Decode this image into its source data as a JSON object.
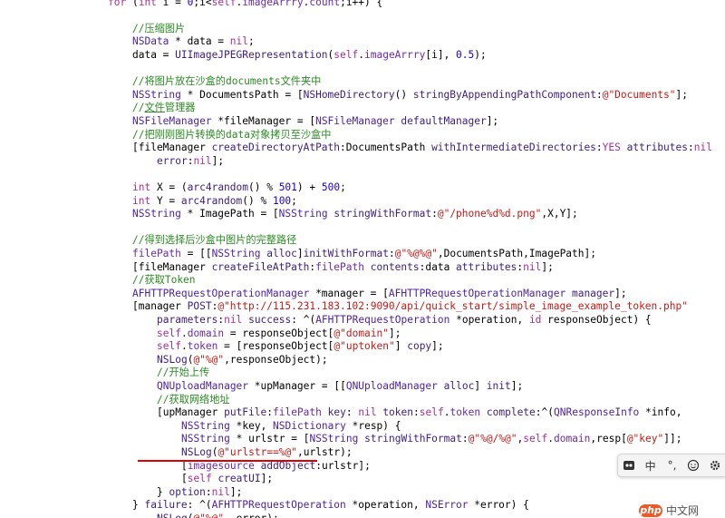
{
  "editor": {
    "lines": [
      {
        "indent": 8,
        "tokens": [
          [
            "kw",
            "for"
          ],
          [
            "p",
            " ("
          ],
          [
            "kw",
            "int"
          ],
          [
            "p",
            " i = "
          ],
          [
            "num",
            "0"
          ],
          [
            "p",
            ";i<"
          ],
          [
            "kw",
            "self"
          ],
          [
            "p",
            "."
          ],
          [
            "prop",
            "imageArrry"
          ],
          [
            "p",
            "."
          ],
          [
            "prop",
            "count"
          ],
          [
            "p",
            ";i++) {"
          ]
        ]
      },
      {
        "indent": 0,
        "tokens": []
      },
      {
        "indent": 12,
        "tokens": [
          [
            "cmt",
            "//压缩图片"
          ]
        ]
      },
      {
        "indent": 12,
        "tokens": [
          [
            "cls",
            "NSData"
          ],
          [
            "p",
            " * data = "
          ],
          [
            "kw",
            "nil"
          ],
          [
            "p",
            ";"
          ]
        ]
      },
      {
        "indent": 12,
        "tokens": [
          [
            "p",
            "data = "
          ],
          [
            "mth",
            "UIImageJPEGRepresentation"
          ],
          [
            "p",
            "("
          ],
          [
            "kw",
            "self"
          ],
          [
            "p",
            "."
          ],
          [
            "prop",
            "imageArrry"
          ],
          [
            "p",
            "[i], "
          ],
          [
            "num",
            "0.5"
          ],
          [
            "p",
            ");"
          ]
        ]
      },
      {
        "indent": 0,
        "tokens": []
      },
      {
        "indent": 12,
        "tokens": [
          [
            "cmt",
            "//将图片放在沙盒的documents文件夹中"
          ]
        ]
      },
      {
        "indent": 12,
        "tokens": [
          [
            "cls",
            "NSString"
          ],
          [
            "p",
            " * DocumentsPath = ["
          ],
          [
            "mth",
            "NSHomeDirectory"
          ],
          [
            "p",
            "() "
          ],
          [
            "mth",
            "stringByAppendingPathComponent"
          ],
          [
            "p",
            ":"
          ],
          [
            "str",
            "@\"Documents\""
          ],
          [
            "p",
            "];"
          ]
        ]
      },
      {
        "indent": 12,
        "tokens": [
          [
            "cmt",
            "//"
          ],
          [
            "link",
            "文件"
          ],
          [
            "cmt",
            "管理器"
          ]
        ]
      },
      {
        "indent": 12,
        "tokens": [
          [
            "cls",
            "NSFileManager"
          ],
          [
            "p",
            " *fileManager = ["
          ],
          [
            "cls",
            "NSFileManager"
          ],
          [
            "p",
            " "
          ],
          [
            "mth",
            "defaultManager"
          ],
          [
            "p",
            "];"
          ]
        ]
      },
      {
        "indent": 12,
        "tokens": [
          [
            "cmt",
            "//把刚刚图片转换的data对象拷贝至沙盒中"
          ]
        ]
      },
      {
        "indent": 12,
        "tokens": [
          [
            "p",
            "[fileManager "
          ],
          [
            "mth",
            "createDirectoryAtPath"
          ],
          [
            "p",
            ":DocumentsPath "
          ],
          [
            "mth",
            "withIntermediateDirectories"
          ],
          [
            "p",
            ":"
          ],
          [
            "kw",
            "YES"
          ],
          [
            "p",
            " "
          ],
          [
            "mth",
            "attributes"
          ],
          [
            "p",
            ":"
          ],
          [
            "kw",
            "nil"
          ]
        ]
      },
      {
        "indent": 16,
        "tokens": [
          [
            "mth",
            "error"
          ],
          [
            "p",
            ":"
          ],
          [
            "kw",
            "nil"
          ],
          [
            "p",
            "];"
          ]
        ]
      },
      {
        "indent": 0,
        "tokens": []
      },
      {
        "indent": 12,
        "tokens": [
          [
            "kw",
            "int"
          ],
          [
            "p",
            " X = ("
          ],
          [
            "mth",
            "arc4random"
          ],
          [
            "p",
            "() % "
          ],
          [
            "num",
            "501"
          ],
          [
            "p",
            ") + "
          ],
          [
            "num",
            "500"
          ],
          [
            "p",
            ";"
          ]
        ]
      },
      {
        "indent": 12,
        "tokens": [
          [
            "kw",
            "int"
          ],
          [
            "p",
            " Y = "
          ],
          [
            "mth",
            "arc4random"
          ],
          [
            "p",
            "() % "
          ],
          [
            "num",
            "100"
          ],
          [
            "p",
            ";"
          ]
        ]
      },
      {
        "indent": 12,
        "tokens": [
          [
            "cls",
            "NSString"
          ],
          [
            "p",
            " * ImagePath = ["
          ],
          [
            "cls",
            "NSString"
          ],
          [
            "p",
            " "
          ],
          [
            "mth",
            "stringWithFormat"
          ],
          [
            "p",
            ":"
          ],
          [
            "str",
            "@\"/phone%d%d.png\""
          ],
          [
            "p",
            ",X,Y];"
          ]
        ]
      },
      {
        "indent": 0,
        "tokens": []
      },
      {
        "indent": 12,
        "tokens": [
          [
            "cmt",
            "//得到选择后沙盒中图片的完整路径"
          ]
        ]
      },
      {
        "indent": 12,
        "tokens": [
          [
            "prop",
            "filePath"
          ],
          [
            "p",
            " = [["
          ],
          [
            "cls",
            "NSString"
          ],
          [
            "p",
            " "
          ],
          [
            "mth",
            "alloc"
          ],
          [
            "p",
            "]"
          ],
          [
            "mth",
            "initWithFormat"
          ],
          [
            "p",
            ":"
          ],
          [
            "str",
            "@\"%@%@\""
          ],
          [
            "p",
            ",DocumentsPath,ImagePath];"
          ]
        ]
      },
      {
        "indent": 12,
        "tokens": [
          [
            "p",
            "[fileManager "
          ],
          [
            "mth",
            "createFileAtPath"
          ],
          [
            "p",
            ":"
          ],
          [
            "prop",
            "filePath"
          ],
          [
            "p",
            " "
          ],
          [
            "mth",
            "contents"
          ],
          [
            "p",
            ":data "
          ],
          [
            "mth",
            "attributes"
          ],
          [
            "p",
            ":"
          ],
          [
            "kw",
            "nil"
          ],
          [
            "p",
            "];"
          ]
        ]
      },
      {
        "indent": 12,
        "tokens": [
          [
            "cmt",
            "//获取Token"
          ]
        ]
      },
      {
        "indent": 12,
        "tokens": [
          [
            "cls",
            "AFHTTPRequestOperationManager"
          ],
          [
            "p",
            " *manager = ["
          ],
          [
            "cls",
            "AFHTTPRequestOperationManager"
          ],
          [
            "p",
            " "
          ],
          [
            "mth",
            "manager"
          ],
          [
            "p",
            "];"
          ]
        ]
      },
      {
        "indent": 12,
        "tokens": [
          [
            "p",
            "[manager "
          ],
          [
            "mth",
            "POST"
          ],
          [
            "p",
            ":"
          ],
          [
            "str",
            "@\"http://115.231.183.102:9090/api/quick_start/simple_image_example_token.php\""
          ]
        ]
      },
      {
        "indent": 16,
        "tokens": [
          [
            "mth",
            "parameters"
          ],
          [
            "p",
            ":"
          ],
          [
            "kw",
            "nil"
          ],
          [
            "p",
            " "
          ],
          [
            "mth",
            "success"
          ],
          [
            "p",
            ": ^("
          ],
          [
            "cls",
            "AFHTTPRequestOperation"
          ],
          [
            "p",
            " *operation, "
          ],
          [
            "kw",
            "id"
          ],
          [
            "p",
            " responseObject) {"
          ]
        ]
      },
      {
        "indent": 16,
        "tokens": [
          [
            "kw",
            "self"
          ],
          [
            "p",
            "."
          ],
          [
            "prop",
            "domain"
          ],
          [
            "p",
            " = responseObject["
          ],
          [
            "str",
            "@\"domain\""
          ],
          [
            "p",
            "];"
          ]
        ]
      },
      {
        "indent": 16,
        "tokens": [
          [
            "kw",
            "self"
          ],
          [
            "p",
            "."
          ],
          [
            "prop",
            "token"
          ],
          [
            "p",
            " = [responseObject["
          ],
          [
            "str",
            "@\"uptoken\""
          ],
          [
            "p",
            "] "
          ],
          [
            "mth",
            "copy"
          ],
          [
            "p",
            "];"
          ]
        ]
      },
      {
        "indent": 16,
        "tokens": [
          [
            "mth",
            "NSLog"
          ],
          [
            "p",
            "("
          ],
          [
            "str",
            "@\"%@\""
          ],
          [
            "p",
            ",responseObject);"
          ]
        ]
      },
      {
        "indent": 16,
        "tokens": [
          [
            "cmt",
            "//开始上传"
          ]
        ]
      },
      {
        "indent": 16,
        "tokens": [
          [
            "cls",
            "QNUploadManager"
          ],
          [
            "p",
            " *upManager = [["
          ],
          [
            "cls",
            "QNUploadManager"
          ],
          [
            "p",
            " "
          ],
          [
            "mth",
            "alloc"
          ],
          [
            "p",
            "] "
          ],
          [
            "mth",
            "init"
          ],
          [
            "p",
            "];"
          ]
        ]
      },
      {
        "indent": 16,
        "tokens": [
          [
            "cmt",
            "//获取网络地址"
          ]
        ]
      },
      {
        "indent": 16,
        "tokens": [
          [
            "p",
            "[upManager "
          ],
          [
            "mth",
            "putFile"
          ],
          [
            "p",
            ":"
          ],
          [
            "prop",
            "filePath"
          ],
          [
            "p",
            " "
          ],
          [
            "mth",
            "key"
          ],
          [
            "p",
            ": "
          ],
          [
            "kw",
            "nil"
          ],
          [
            "p",
            " "
          ],
          [
            "mth",
            "token"
          ],
          [
            "p",
            ":"
          ],
          [
            "kw",
            "self"
          ],
          [
            "p",
            "."
          ],
          [
            "prop",
            "token"
          ],
          [
            "p",
            " "
          ],
          [
            "mth",
            "complete"
          ],
          [
            "p",
            ":^("
          ],
          [
            "cls",
            "QNResponseInfo"
          ],
          [
            "p",
            " *info,"
          ]
        ]
      },
      {
        "indent": 20,
        "tokens": [
          [
            "cls",
            "NSString"
          ],
          [
            "p",
            " *key, "
          ],
          [
            "cls",
            "NSDictionary"
          ],
          [
            "p",
            " *resp) {"
          ]
        ]
      },
      {
        "indent": 20,
        "tokens": [
          [
            "cls",
            "NSString"
          ],
          [
            "p",
            " * urlstr = ["
          ],
          [
            "cls",
            "NSString"
          ],
          [
            "p",
            " "
          ],
          [
            "mth",
            "stringWithFormat"
          ],
          [
            "p",
            ":"
          ],
          [
            "str",
            "@\"%@/%@\""
          ],
          [
            "p",
            ","
          ],
          [
            "kw",
            "self"
          ],
          [
            "p",
            "."
          ],
          [
            "prop",
            "domain"
          ],
          [
            "p",
            ",resp["
          ],
          [
            "str",
            "@\"key\""
          ],
          [
            "p",
            "]];"
          ]
        ]
      },
      {
        "indent": 20,
        "tokens": [
          [
            "mth",
            "NSLog"
          ],
          [
            "p",
            "("
          ],
          [
            "str",
            "@\"urlstr==%@\""
          ],
          [
            "p",
            ",urlstr);"
          ]
        ]
      },
      {
        "indent": 20,
        "tokens": [
          [
            "p",
            "["
          ],
          [
            "prop",
            "imagesource"
          ],
          [
            "p",
            " "
          ],
          [
            "mth",
            "addObject"
          ],
          [
            "p",
            ":urlstr];"
          ]
        ]
      },
      {
        "indent": 20,
        "tokens": [
          [
            "p",
            "["
          ],
          [
            "kw",
            "self"
          ],
          [
            "p",
            " "
          ],
          [
            "mth",
            "creatUI"
          ],
          [
            "p",
            "];"
          ]
        ]
      },
      {
        "indent": 16,
        "tokens": [
          [
            "p",
            "} "
          ],
          [
            "mth",
            "option"
          ],
          [
            "p",
            ":"
          ],
          [
            "kw",
            "nil"
          ],
          [
            "p",
            "];"
          ]
        ]
      },
      {
        "indent": 12,
        "tokens": [
          [
            "p",
            "} "
          ],
          [
            "mth",
            "failure"
          ],
          [
            "p",
            ": ^("
          ],
          [
            "cls",
            "AFHTTPRequestOperation"
          ],
          [
            "p",
            " *operation, "
          ],
          [
            "cls",
            "NSError"
          ],
          [
            "p",
            " *error) {"
          ]
        ]
      },
      {
        "indent": 16,
        "tokens": [
          [
            "mth",
            "NSLog"
          ],
          [
            "p",
            "("
          ],
          [
            "str",
            "@\"%@\""
          ],
          [
            "p",
            ", error);"
          ]
        ]
      }
    ]
  },
  "ime_toolbar": {
    "buttons": [
      {
        "name": "ime-logo-icon",
        "label": ""
      },
      {
        "name": "ime-mode-chinese",
        "label": "中"
      },
      {
        "name": "ime-punctuation-toggle",
        "label": "°,"
      },
      {
        "name": "ime-emoji-icon",
        "label": ""
      },
      {
        "name": "ime-settings-icon",
        "label": ""
      }
    ]
  },
  "watermark": {
    "logo_text": "php",
    "text": "中文网"
  }
}
